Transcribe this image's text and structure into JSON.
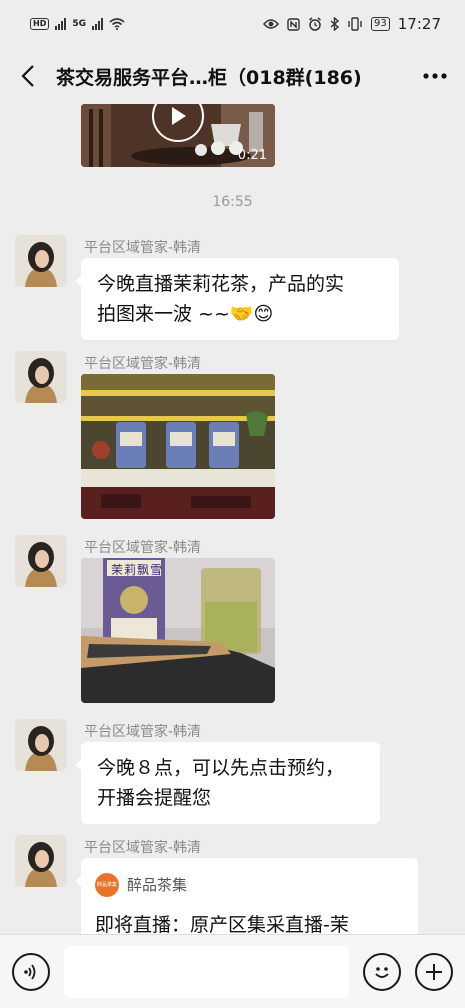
{
  "status_bar": {
    "hd_label": "HD",
    "network_label": "5G",
    "battery": "93",
    "time": "17:27"
  },
  "header": {
    "title": "茶交易服务平台…柜（018群(186)"
  },
  "chat": {
    "video_duration": "0:21",
    "timestamp": "16:55",
    "messages": [
      {
        "sender": "平台区域管家-韩清",
        "text_line1": "今晚直播茉莉花茶，产品的实",
        "text_line2": "拍图来一波 ~~🤝😊"
      },
      {
        "sender": "平台区域管家-韩清"
      },
      {
        "sender": "平台区域管家-韩清",
        "tin_label": "茉莉飘雪"
      },
      {
        "sender": "平台区域管家-韩清",
        "text_line1": "今晚８点，可以先点击预约，",
        "text_line2": "开播会提醒您"
      },
      {
        "sender": "平台区域管家-韩清",
        "card_source": "醉品茶集",
        "card_title": "即将直播：原产区集采直播-茉",
        "card_logo_text": "醉品茶集"
      }
    ]
  },
  "colors": {
    "background": "#ededed",
    "bubble": "#ffffff",
    "sender_name": "#8a8a8a",
    "card_logo": "#e8742c"
  },
  "icons": {
    "back": "chevron-left-icon",
    "more": "more-dots-icon",
    "voice": "voice-icon",
    "emoji": "emoji-icon",
    "add": "plus-icon",
    "play": "play-icon"
  }
}
